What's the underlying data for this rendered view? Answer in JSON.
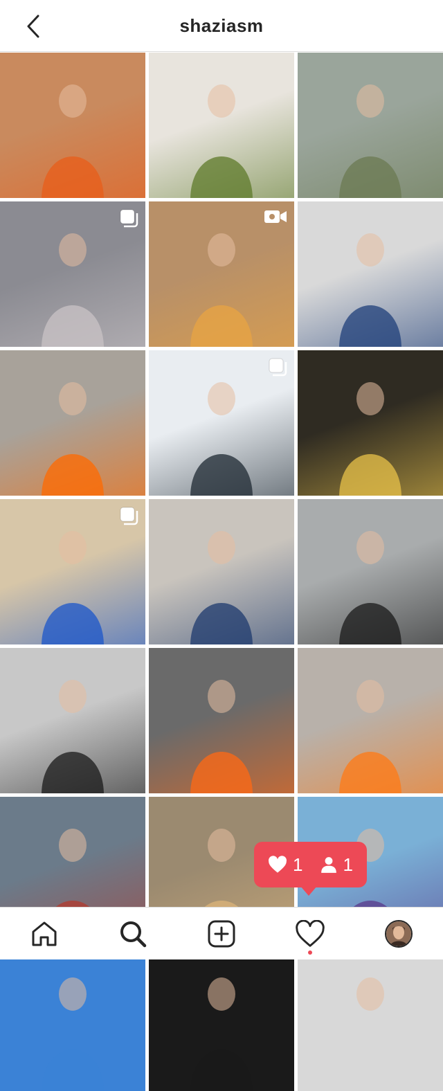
{
  "header": {
    "title": "shaziasm"
  },
  "grid": {
    "tiles": [
      {
        "row": 0,
        "col": 0,
        "bg": "#c98a5e",
        "accent": "#e85d1a",
        "badge": null
      },
      {
        "row": 0,
        "col": 1,
        "bg": "#e8e4dd",
        "accent": "#5e7a2a",
        "badge": null
      },
      {
        "row": 0,
        "col": 2,
        "bg": "#9aa59b",
        "accent": "#6b7a52",
        "badge": null
      },
      {
        "row": 1,
        "col": 0,
        "bg": "#8b8b92",
        "accent": "#c9c3c6",
        "badge": "carousel"
      },
      {
        "row": 1,
        "col": 1,
        "bg": "#b89068",
        "accent": "#e8a443",
        "badge": "video"
      },
      {
        "row": 1,
        "col": 2,
        "bg": "#d9d9d9",
        "accent": "#1f3f7a",
        "badge": null
      },
      {
        "row": 2,
        "col": 0,
        "bg": "#a8a29a",
        "accent": "#ff6a00",
        "badge": null
      },
      {
        "row": 2,
        "col": 1,
        "bg": "#e9edf1",
        "accent": "#1f2a33",
        "badge": "carousel"
      },
      {
        "row": 2,
        "col": 2,
        "bg": "#2f2b22",
        "accent": "#e8c24a",
        "badge": null
      },
      {
        "row": 3,
        "col": 0,
        "bg": "#d7c6a8",
        "accent": "#1b56c9",
        "badge": "carousel"
      },
      {
        "row": 3,
        "col": 1,
        "bg": "#c9c4bd",
        "accent": "#1d3a6e",
        "badge": null
      },
      {
        "row": 3,
        "col": 2,
        "bg": "#a9acad",
        "accent": "#1a1a1a",
        "badge": null
      },
      {
        "row": 4,
        "col": 0,
        "bg": "#c8c8c8",
        "accent": "#1a1a1a",
        "badge": null
      },
      {
        "row": 4,
        "col": 1,
        "bg": "#6a6a6a",
        "accent": "#ff6a14",
        "badge": null
      },
      {
        "row": 4,
        "col": 2,
        "bg": "#b8b1aa",
        "accent": "#ff7a14",
        "badge": null
      },
      {
        "row": 5,
        "col": 0,
        "bg": "#6b7b8a",
        "accent": "#b33a2e",
        "badge": null
      },
      {
        "row": 5,
        "col": 1,
        "bg": "#9b8a70",
        "accent": "#dcb47a",
        "badge": null
      },
      {
        "row": 5,
        "col": 2,
        "bg": "#7ab0d6",
        "accent": "#5a3a8a",
        "badge": null
      },
      {
        "row": 6,
        "col": 0,
        "bg": "#3b82d6",
        "accent": "#3b82d6",
        "badge": null
      },
      {
        "row": 6,
        "col": 1,
        "bg": "#1a1a1a",
        "accent": "#1a1a1a",
        "badge": null
      },
      {
        "row": 6,
        "col": 2,
        "bg": "#d8d8d8",
        "accent": "#d8d8d8",
        "badge": null
      }
    ]
  },
  "toast": {
    "likes": "1",
    "followers": "1"
  },
  "colors": {
    "accent": "#ed4956",
    "text": "#262626",
    "divider": "#dbdbdb"
  },
  "nav": {
    "items": [
      "home-icon",
      "search-icon",
      "add-post-icon",
      "heart-icon",
      "profile-avatar"
    ]
  }
}
